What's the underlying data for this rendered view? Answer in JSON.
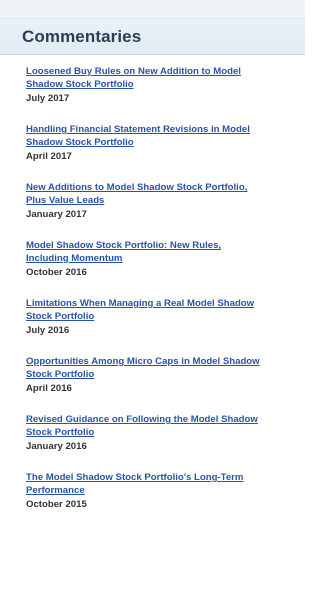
{
  "header": {
    "title": "Commentaries"
  },
  "commentaries": [
    {
      "title": "Loosened Buy Rules on New Addition to Model\nShadow Stock Portfolio",
      "date": "July 2017"
    },
    {
      "title": "Handling Financial Statement Revisions in Model\nShadow Stock Portfolio",
      "date": "April 2017"
    },
    {
      "title": "New Additions to Model Shadow Stock Portfolio,\nPlus Value Leads",
      "date": "January 2017"
    },
    {
      "title": "Model Shadow Stock Portfolio: New Rules,\nIncluding Momentum",
      "date": "October 2016"
    },
    {
      "title": "Limitations When Managing a Real Model Shadow\nStock Portfolio",
      "date": "July 2016"
    },
    {
      "title": "Opportunities Among Micro Caps in Model Shadow\nStock Portfolio",
      "date": "April 2016"
    },
    {
      "title": "Revised Guidance on Following the Model Shadow\nStock Portfolio",
      "date": "January 2016"
    },
    {
      "title": "The Model Shadow Stock Portfolio's Long-Term\nPerformance",
      "date": "October 2015"
    }
  ]
}
